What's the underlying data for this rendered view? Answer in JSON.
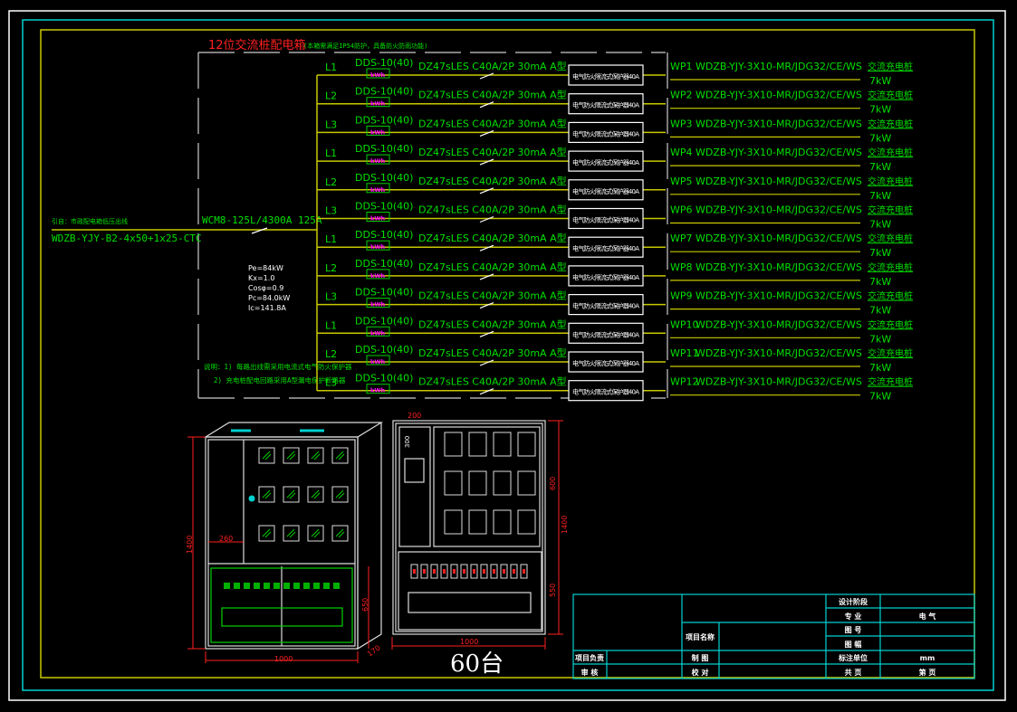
{
  "title": "12位交流桩配电箱",
  "title_note": "(本箱需满足IP54防护，具备防火防雨功能)",
  "incoming": {
    "note": "引自：市政配电箱低压出线",
    "cable": "WDZB-YJY-B2-4x50+1x25-CTC",
    "breaker": "WCM8-125L/4300A 125A"
  },
  "load_calc": [
    "Pe=84kW",
    "Kx=1.0",
    "Cosφ=0.9",
    "Pc=84.0kW",
    "Ic=141.8A"
  ],
  "notes": [
    "说明：1) 每路出线需采用电流式电气防火保护器",
    "2) 充电桩配电回路采用A型漏电保护断路器"
  ],
  "circuit": {
    "meter": "DDS-10(40)",
    "meter_unit": "kWh",
    "breaker": "DZ47sLES C40A/2P 30mA A型",
    "protector": "电气防火限流式保护器40A",
    "cable": "WDZB-YJY-3X10-MR/JDG32/CE/WS",
    "load": "交流充电桩",
    "power": "7kW"
  },
  "circuits": [
    {
      "phase": "L1",
      "id": "WP1"
    },
    {
      "phase": "L2",
      "id": "WP2"
    },
    {
      "phase": "L3",
      "id": "WP3"
    },
    {
      "phase": "L1",
      "id": "WP4"
    },
    {
      "phase": "L2",
      "id": "WP5"
    },
    {
      "phase": "L3",
      "id": "WP6"
    },
    {
      "phase": "L1",
      "id": "WP7"
    },
    {
      "phase": "L2",
      "id": "WP8"
    },
    {
      "phase": "L3",
      "id": "WP9"
    },
    {
      "phase": "L1",
      "id": "WP10"
    },
    {
      "phase": "L2",
      "id": "WP11"
    },
    {
      "phase": "L3",
      "id": "WP12"
    }
  ],
  "cabinet": {
    "dims": {
      "height": "1400",
      "left_width": "260",
      "lower_height": "650",
      "width": "1000",
      "depth": "170",
      "top": "200",
      "meter_gap": "300",
      "upper": "600",
      "total": "1400",
      "lower": "550",
      "inner_width": "1000"
    },
    "quantity": "60台"
  },
  "title_block": {
    "design_stage": "设计阶段",
    "discipline": "专  业",
    "discipline_value": "电  气",
    "drawing_no": "图  号",
    "sheet_size": "图  幅",
    "unit": "标注单位",
    "unit_value": "mm",
    "total_pages": "共    页",
    "page": "第    页",
    "project_name": "项目名称",
    "project_lead": "项目负责",
    "review": "审  核",
    "drawn": "制  图",
    "checked": "校  对"
  },
  "colors": {
    "bus": "#c8c800",
    "text": "#00e000",
    "frame": "#00d0d0",
    "dim": "#ff2020",
    "meter": "#ff00ff"
  }
}
